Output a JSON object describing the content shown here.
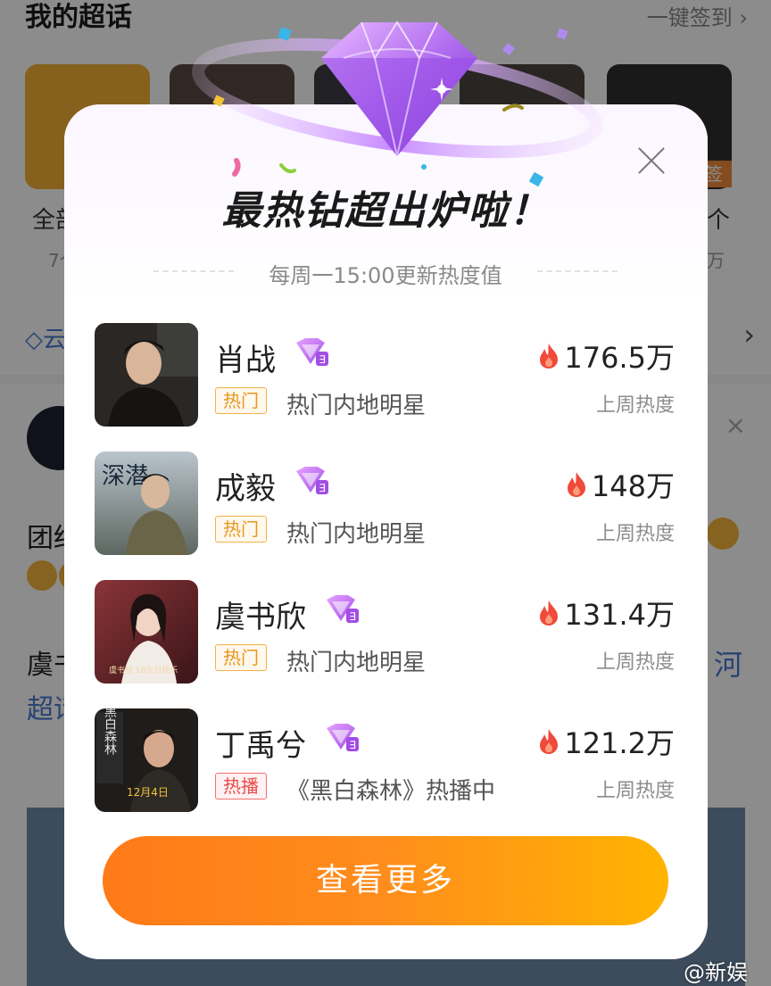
{
  "background": {
    "section_title": "我的超话",
    "sign_in_label": "一键签到",
    "sign_in_arrow": "›",
    "tile_label_1": "全部",
    "tile_count_1": "7个",
    "tile_label_3": "个",
    "tile_count_3": "万",
    "tile_badge": "签",
    "diamond_row_text": "云",
    "row_arrow": "›",
    "post_text_1": "团结",
    "post_text_2": "虞书",
    "post_text_3": "超话",
    "post_text_4": "河",
    "close_glyph": "×"
  },
  "modal": {
    "title": "最热钻超出炉啦！",
    "subtitle": "每周一15:00更新热度值",
    "more_button": "查看更多",
    "items": [
      {
        "name": "肖战",
        "tag": "热门",
        "tag_type": "hot",
        "desc": "热门内地明星",
        "heat": "176.5万",
        "heat_label": "上周热度",
        "thumb_color": "#2b2724"
      },
      {
        "name": "成毅",
        "tag": "热门",
        "tag_type": "hot",
        "desc": "热门内地明星",
        "heat": "148万",
        "heat_label": "上周热度",
        "thumb_color": "#8a8f96"
      },
      {
        "name": "虞书欣",
        "tag": "热门",
        "tag_type": "hot",
        "desc": "热门内地明星",
        "heat": "131.4万",
        "heat_label": "上周热度",
        "thumb_color": "#6e2b2e"
      },
      {
        "name": "丁禹兮",
        "tag": "热播",
        "tag_type": "play",
        "desc": "《黑白森林》热播中",
        "heat": "121.2万",
        "heat_label": "上周热度",
        "thumb_color": "#1f1c1a"
      }
    ]
  },
  "thumbs": {
    "thumb_2_text": "深潜",
    "thumb_3_text": "虞书欣 18生日快乐",
    "thumb_4_text": "黑白森林",
    "thumb_4_date": "12月4日"
  },
  "icons": {
    "close": "close-icon",
    "gem": "diamond-gem-icon",
    "badge": "diamond-badge-icon",
    "flame": "flame-icon"
  },
  "colors": {
    "accent_orange": "#ff8a1c",
    "hot_tag": "#e8961f",
    "play_tag": "#e84a4a",
    "flame": "#f04a3a",
    "gem_purple": "#b06cf0"
  },
  "watermark": "@新娱"
}
